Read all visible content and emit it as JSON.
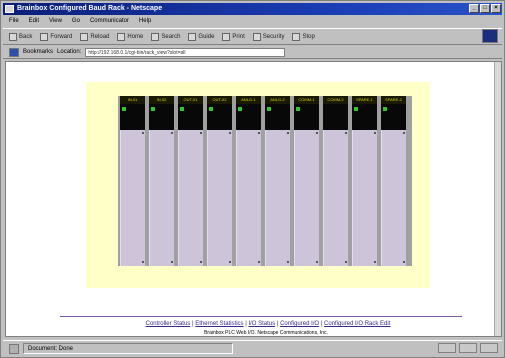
{
  "window": {
    "title": "Brainbox Configured Baud Rack - Netscape",
    "controls": [
      "_",
      "□",
      "×"
    ]
  },
  "menu": [
    "File",
    "Edit",
    "View",
    "Go",
    "Communicator",
    "Help"
  ],
  "toolbar": [
    "Back",
    "Forward",
    "Reload",
    "Home",
    "Search",
    "Guide",
    "Print",
    "Security",
    "Stop"
  ],
  "location": {
    "bookmarks_label": "Bookmarks",
    "location_label": "Location:",
    "url": "http://192.168.0.1/cgi-bin/rack_view?slot=all"
  },
  "rack": {
    "slots": [
      {
        "label": "IN-01",
        "led": true
      },
      {
        "label": "IN-02",
        "led": true
      },
      {
        "label": "OUT-01",
        "led": true
      },
      {
        "label": "OUT-02",
        "led": true
      },
      {
        "label": "ANLG-1",
        "led": true
      },
      {
        "label": "ANLG-2",
        "led": true
      },
      {
        "label": "COMM-1",
        "led": true
      },
      {
        "label": "COMM-2",
        "led": false
      },
      {
        "label": "SPARE-1",
        "led": true
      },
      {
        "label": "SPARE-2",
        "led": true
      }
    ]
  },
  "footer": {
    "links": [
      "Controller Status",
      "Ethernet Statistics",
      "I/O Status",
      "Configured I/O",
      "Configured I/O Rack Edit"
    ],
    "separator": " | ",
    "copyright": "Brainbox PLC Web I/O. Netscape Communications, Inc."
  },
  "status": {
    "text": "Document: Done"
  },
  "colors": {
    "panel_bg": "#ffffc8",
    "slot_body": "#cec6d8",
    "led_on": "#2ec82e",
    "link": "#3a2a8a"
  }
}
